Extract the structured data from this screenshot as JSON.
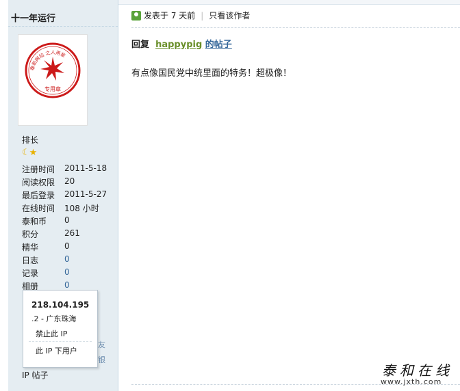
{
  "author": {
    "name": "十一年运行"
  },
  "avatar": {
    "seal_text": "泰和网站 之人用章",
    "seal_center": "专用章"
  },
  "profile": {
    "rank": "排长",
    "stars_icons": "☾★",
    "stats": [
      {
        "k": "注册时间",
        "v": "2011-5-18",
        "link": false
      },
      {
        "k": "阅读权限",
        "v": "20",
        "link": false
      },
      {
        "k": "最后登录",
        "v": "2011-5-27",
        "link": false
      },
      {
        "k": "在线时间",
        "v": "108 小时",
        "link": false
      },
      {
        "k": "泰和币",
        "v": "0",
        "link": false
      },
      {
        "k": "积分",
        "v": "261",
        "link": false
      },
      {
        "k": "精华",
        "v": "0",
        "link": false
      },
      {
        "k": "日志",
        "v": "0",
        "link": true
      },
      {
        "k": "记录",
        "v": "0",
        "link": true
      },
      {
        "k": "相册",
        "v": "0",
        "link": true
      }
    ]
  },
  "ip_popup": {
    "address_line1": "218.104.195",
    "address_line2": ".2 - 广东珠海",
    "ban_link": "禁止此 IP",
    "users_link": "此 IP 下用户",
    "frag1": "友",
    "frag2": "银"
  },
  "ip_tail": "IP  帖子",
  "post": {
    "posted_prefix": "发表于",
    "posted_time": "7 天前",
    "only_author": "只看该作者",
    "reply_prefix": "回复",
    "reply_user": "happypig",
    "reply_suffix": "的帖子",
    "content": "有点像国民党中统里面的特务！超极像！"
  },
  "watermark": {
    "text": "泰和在线",
    "url": "www.jxth.com"
  }
}
